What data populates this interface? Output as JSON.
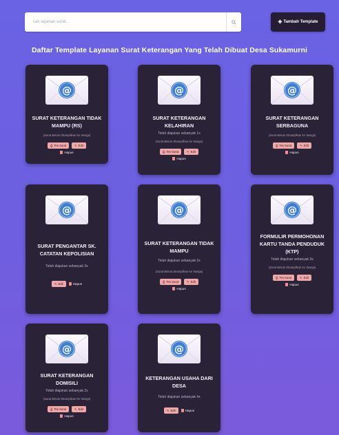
{
  "search": {
    "placeholder": "cari layanan surat..."
  },
  "add_button": {
    "label": "Tambah Template"
  },
  "page_title": "Daftar Template Layanan Surat Keterangan Yang Telah Dibuat Desa Sukamurni",
  "labels": {
    "test": "Tes Surat",
    "edit": "Edit",
    "delete": "Hapus",
    "note": "(Surat Belum Ditampilkan Ke Warga)"
  },
  "cards": [
    {
      "title": "SURAT KETERANGAN TIDAK MAMPU (RS)",
      "count": ""
    },
    {
      "title": "SURAT KETERANGAN KELAHIRAN",
      "count": "Telah diajukan sebanyak 1x"
    },
    {
      "title": "SURAT KETERANGAN SERBAGUNA",
      "count": ""
    },
    {
      "title": "SURAT PENGANTAR SK. CATATAN KEPOLISIAN",
      "count": "Telah diajukan sebanyak 3x"
    },
    {
      "title": "SURAT KETERANGAN TIDAK MAMPU",
      "count": "Telah diajukan sebanyak 2x"
    },
    {
      "title": "FORMULIR PERMOHONAN KARTU TANDA PENDUDUK (KTP)",
      "count": "Telah diajukan sebanyak 3x"
    },
    {
      "title": "SURAT KETERANGAN DOMISILI",
      "count": "Telah diajukan sebanyak 2x"
    },
    {
      "title": "KETERANGAN USAHA DARI DESA",
      "count": "Telah diajukan sebanyak 4x"
    }
  ]
}
